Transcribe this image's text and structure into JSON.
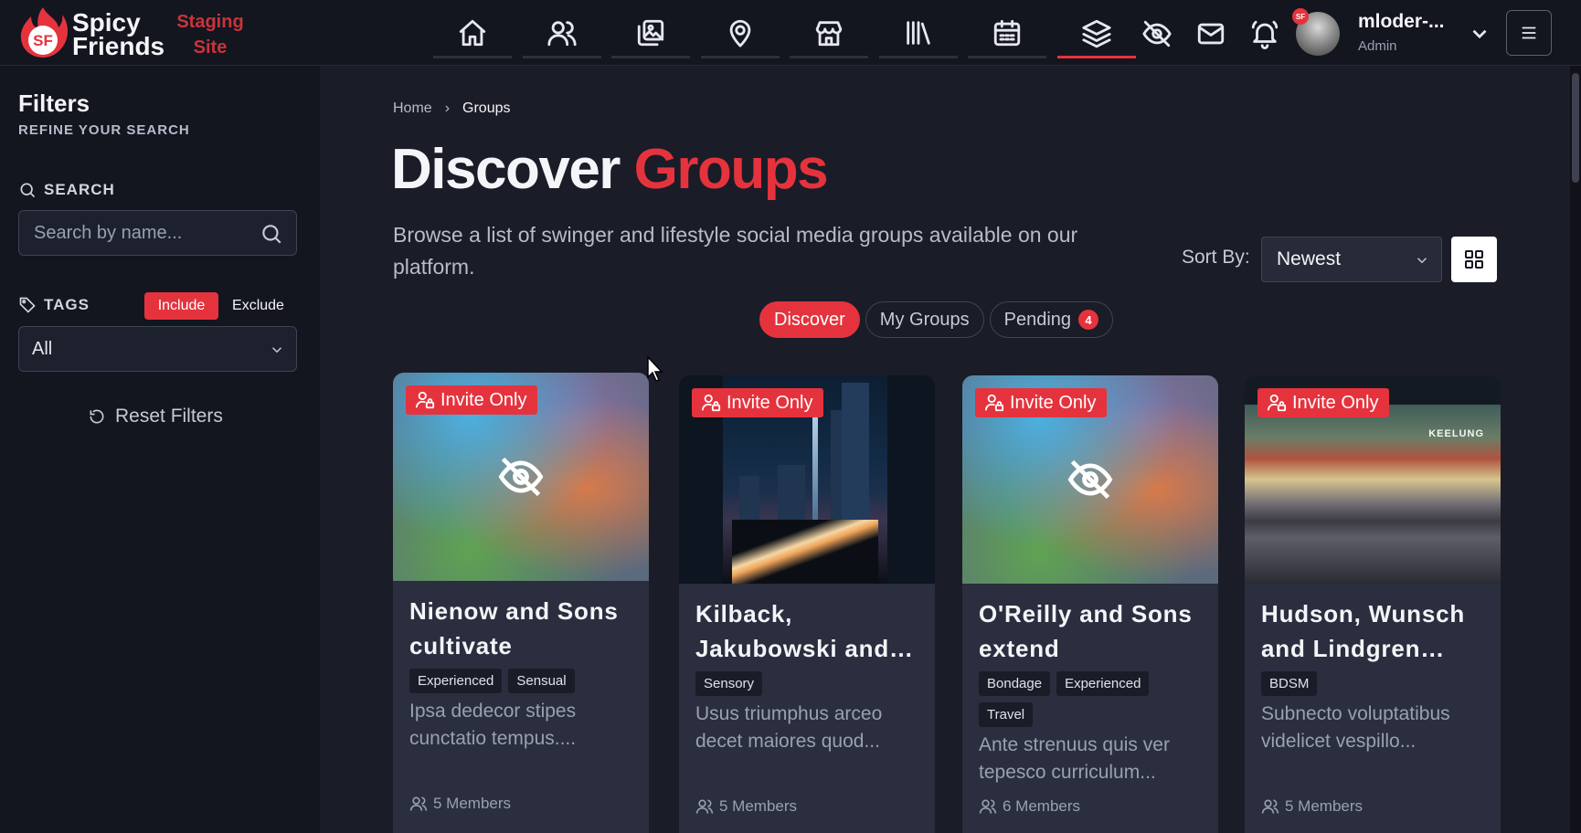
{
  "brand": {
    "name_line1": "Spicy",
    "name_line2": "Friends",
    "logo_letters": "SF",
    "env_line1": "Staging",
    "env_line2": "Site",
    "accent_color": "#e5333d"
  },
  "nav": {
    "icons": [
      "home-icon",
      "users-icon",
      "gallery-icon",
      "location-icon",
      "store-icon",
      "library-icon",
      "calendar-icon",
      "layers-icon"
    ],
    "active": "layers-icon",
    "extra_icons": [
      "eye-off-icon",
      "mail-icon",
      "bell-icon"
    ]
  },
  "user": {
    "name": "mloder-...",
    "role": "Admin",
    "avatar_badge": "SF"
  },
  "sidebar": {
    "title": "Filters",
    "subtitle": "REFINE YOUR SEARCH",
    "search_label": "SEARCH",
    "search_placeholder": "Search by name...",
    "tags_label": "TAGS",
    "include_label": "Include",
    "exclude_label": "Exclude",
    "tags_value": "All",
    "reset_label": "Reset Filters"
  },
  "main": {
    "breadcrumb": {
      "home": "Home",
      "current": "Groups"
    },
    "title_prefix": "Discover",
    "title_accent": "Groups",
    "description": "Browse a list of swinger and lifestyle social media groups available on our platform.",
    "sort_label": "Sort By:",
    "sort_value": "Newest",
    "tabs": [
      {
        "label": "Discover"
      },
      {
        "label": "My Groups"
      },
      {
        "label": "Pending",
        "count": "4"
      }
    ]
  },
  "cards": [
    {
      "badge": "Invite Only",
      "title": "Nienow and Sons cultivate",
      "tags": [
        "Experienced",
        "Sensual"
      ],
      "description": "Ipsa dedecor stipes cunctatio tempus....",
      "members": "5 Members",
      "image": "hidden"
    },
    {
      "badge": "Invite Only",
      "title": "Kilback, Jakubowski and Lindgren",
      "tags": [
        "Sensory"
      ],
      "description": "Usus triumphus arceo decet maiores quod...",
      "members": "5 Members",
      "image": "city"
    },
    {
      "badge": "Invite Only",
      "title": "O'Reilly and Sons extend",
      "tags": [
        "Bondage",
        "Experienced",
        "Travel"
      ],
      "description": "Ante strenuus quis ver tepesco curriculum...",
      "members": "6 Members",
      "image": "hidden"
    },
    {
      "badge": "Invite Only",
      "title": "Hudson, Wunsch and Lindgren implement",
      "tags": [
        "BDSM"
      ],
      "description": "Subnecto voluptatibus videlicet vespillo...",
      "members": "5 Members",
      "image": "town",
      "image_sign": "KEELUNG"
    }
  ]
}
